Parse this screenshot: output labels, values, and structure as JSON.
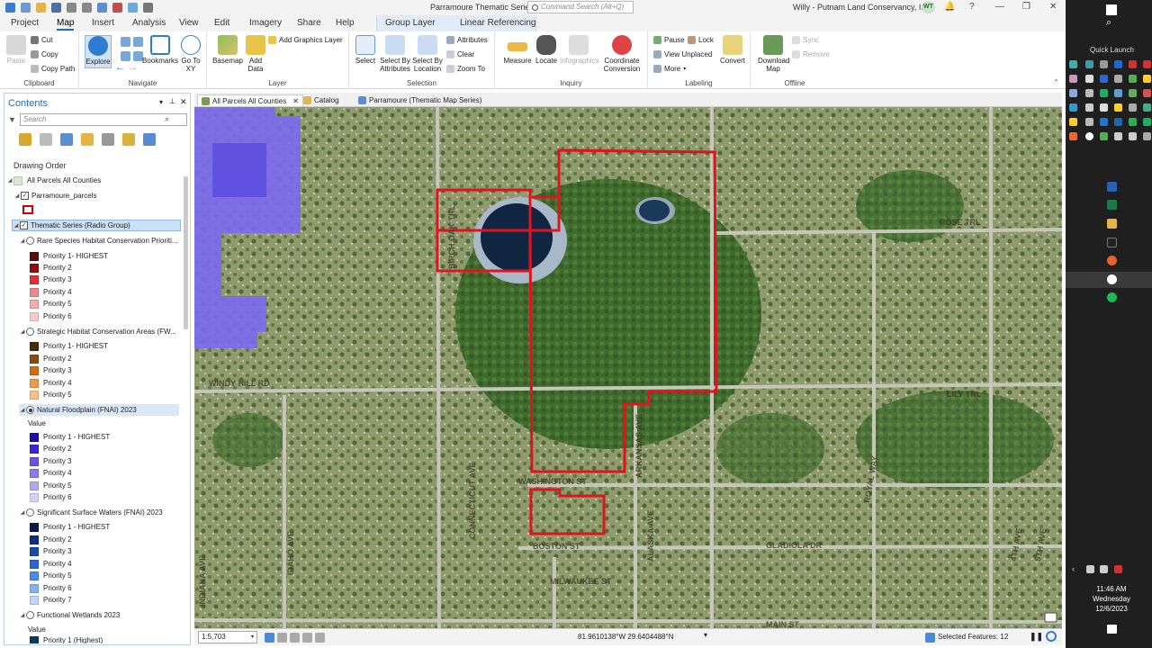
{
  "app": {
    "title": "Parramoure Thematic Series",
    "command_search_placeholder": "Command Search (Alt+Q)",
    "user_name": "Willy - Putnam Land Conservancy, Inc.",
    "user_initials": "WT"
  },
  "ribbon_tabs": [
    "Project",
    "Map",
    "Insert",
    "Analysis",
    "View",
    "Edit",
    "Imagery",
    "Share",
    "Help"
  ],
  "active_tab": "Map",
  "context_tabs": [
    "Group Layer",
    "Linear Referencing"
  ],
  "ribbon": {
    "clipboard": {
      "label": "Clipboard",
      "paste": "Paste",
      "cut": "Cut",
      "copy": "Copy",
      "copy_path": "Copy Path"
    },
    "navigate": {
      "label": "Navigate",
      "explore": "Explore",
      "bookmarks": "Bookmarks",
      "go_to_xy": "Go To XY"
    },
    "layer": {
      "label": "Layer",
      "basemap": "Basemap",
      "add_data": "Add Data",
      "add_graphics_layer": "Add Graphics Layer"
    },
    "selection": {
      "label": "Selection",
      "select": "Select",
      "select_by_attributes": "Select By Attributes",
      "select_by_location": "Select By Location",
      "attributes": "Attributes",
      "clear": "Clear",
      "zoom_to": "Zoom To"
    },
    "inquiry": {
      "label": "Inquiry",
      "measure": "Measure",
      "locate": "Locate",
      "infographics": "Infographics",
      "coordinate_conversion": "Coordinate Conversion"
    },
    "labeling": {
      "label": "Labeling",
      "pause": "Pause",
      "lock": "Lock",
      "view_unplaced": "View Unplaced",
      "more": "More",
      "convert": "Convert"
    },
    "offline": {
      "label": "Offline",
      "download_map": "Download Map",
      "sync": "Sync",
      "remove": "Remove"
    }
  },
  "contents": {
    "title": "Contents",
    "search_placeholder": "Search",
    "drawing_order": "Drawing Order",
    "map_name": "All Parcels All Counties",
    "parcels_layer": "Parramoure_parcels",
    "thematic_group": "Thematic Series (Radio Group)",
    "value_label": "Value",
    "layers": [
      {
        "name": "Rare Species Habitat Conservation Prioriti...",
        "classes": [
          "Priority 1- HIGHEST",
          "Priority 2",
          "Priority 3",
          "Priority 4",
          "Priority 5",
          "Priority 6"
        ],
        "colors": [
          "#5a0d0d",
          "#8c1212",
          "#d93333",
          "#ec8a8a",
          "#f2aaaa",
          "#f7cccc"
        ]
      },
      {
        "name": "Strategic Habitat Conservation Areas (FW...",
        "classes": [
          "Priority 1- HIGHEST",
          "Priority 2",
          "Priority 3",
          "Priority 4",
          "Priority 5"
        ],
        "colors": [
          "#4a2c12",
          "#8a4a14",
          "#d66a14",
          "#ef9a4a",
          "#f5c28a"
        ]
      },
      {
        "name": "Natural Floodplain (FNAI) 2023",
        "classes": [
          "Priority 1 - HIGHEST",
          "Priority 2",
          "Priority 3",
          "Priority 4",
          "Priority 5",
          "Priority 6"
        ],
        "colors": [
          "#1a0fa8",
          "#3b26d6",
          "#6a52e0",
          "#8d7ae8",
          "#b3a8ef",
          "#d6d0f6"
        ]
      },
      {
        "name": "Significant Surface Waters (FNAI) 2023",
        "classes": [
          "Priority 1 - HIGHEST",
          "Priority 2",
          "Priority 3",
          "Priority 4",
          "Priority 5",
          "Priority 6",
          "Priority 7"
        ],
        "colors": [
          "#0a1a4a",
          "#12307a",
          "#1a4aaa",
          "#2a66d6",
          "#4a8aea",
          "#86b2f2",
          "#c2d6f8"
        ]
      },
      {
        "name": "Functional Wetlands 2023",
        "classes": [],
        "colors": []
      }
    ],
    "last_class_partial": "Priority 1 (Highest)"
  },
  "map_tabs": [
    "All Parcels All Counties",
    "Catalog",
    "Parramoure (Thematic Map Series)"
  ],
  "map_labels": [
    "BIRCH OAK TRL",
    "ROSE TRL",
    "WINDY HILL RD",
    "LILY TRL",
    "WASHINGTON ST",
    "ARKANSAS AVE",
    "ROYAL WAY",
    "BOSTON ST",
    "GLADIOLA DR",
    "MILWAUKEE ST",
    "ALASKA AVE",
    "CONNECTICUT AVE",
    "INDIANA AVE",
    "IDAHO AVE",
    "MAIN ST",
    "4TH AVE",
    "5TH AVE"
  ],
  "status": {
    "scale": "1:5,703",
    "coordinates": "81.9610138°W 29.6404488°N",
    "selected_features": "Selected Features: 12"
  },
  "taskbar": {
    "quick_launch": "Quick Launch",
    "time": "11:46 AM",
    "day": "Wednesday",
    "date": "12/6/2023"
  }
}
